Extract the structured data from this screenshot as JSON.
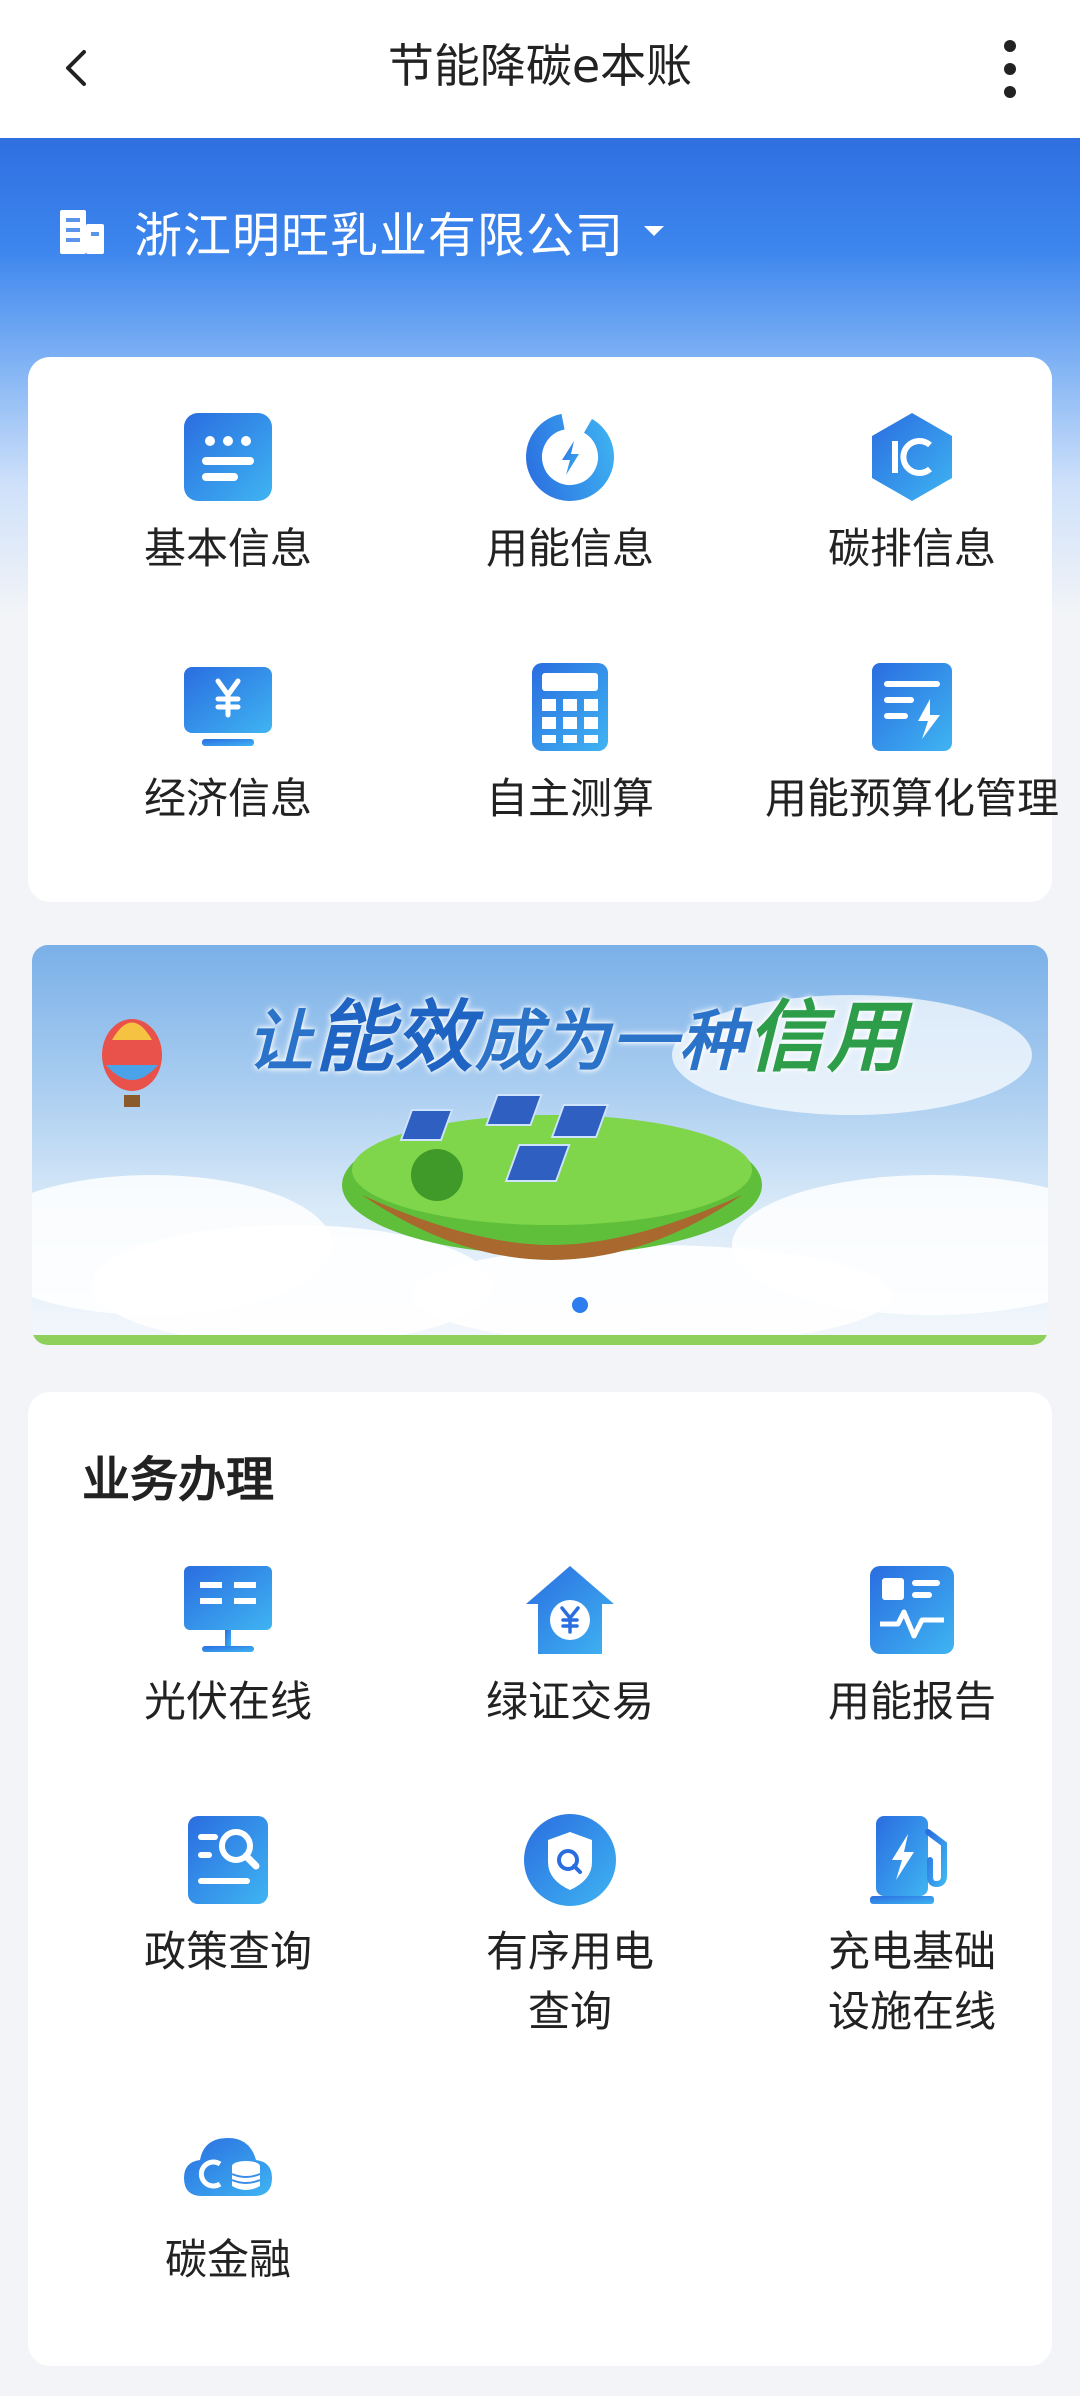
{
  "header": {
    "title": "节能降碳e本账"
  },
  "company": {
    "name": "浙江明旺乳业有限公司"
  },
  "info_grid": [
    {
      "label": "基本信息",
      "icon": "info-list-icon"
    },
    {
      "label": "用能信息",
      "icon": "energy-gauge-icon"
    },
    {
      "label": "碳排信息",
      "icon": "carbon-hexagon-icon"
    },
    {
      "label": "经济信息",
      "icon": "yuan-monitor-icon"
    },
    {
      "label": "自主测算",
      "icon": "calculator-icon"
    },
    {
      "label": "用能预算化管理",
      "icon": "budget-doc-icon"
    }
  ],
  "banner": {
    "text_part1": "让",
    "text_part2": "能效",
    "text_part3": "成为一种",
    "text_part4": "信用"
  },
  "business": {
    "title": "业务办理",
    "items": [
      {
        "label": "光伏在线",
        "icon": "solar-panel-icon"
      },
      {
        "label": "绿证交易",
        "icon": "green-cert-house-icon"
      },
      {
        "label": "用能报告",
        "icon": "report-icon"
      },
      {
        "label": "政策查询",
        "icon": "policy-search-icon"
      },
      {
        "label_line1": "有序用电",
        "label_line2": "查询",
        "icon": "shield-search-icon"
      },
      {
        "label_line1": "充电基础",
        "label_line2": "设施在线",
        "icon": "charging-station-icon"
      },
      {
        "label": "碳金融",
        "icon": "carbon-finance-icon"
      }
    ]
  },
  "colors": {
    "primary": "#2c7ef0",
    "icon_gradient_start": "#2a6de0",
    "icon_gradient_end": "#3fb4f2"
  }
}
